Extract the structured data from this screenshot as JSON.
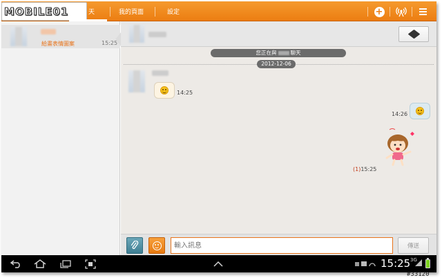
{
  "app": {
    "logo_text": "MOBILE01"
  },
  "tabs": [
    {
      "label": "聊天",
      "visible_label": "天",
      "active": true
    },
    {
      "label": "我的頁面",
      "active": false
    },
    {
      "label": "設定",
      "active": false
    }
  ],
  "top_icons": [
    "add-friend-icon",
    "signal-icon",
    "menu-icon"
  ],
  "conversation_list": [
    {
      "last_message": "給畫表情圖案",
      "time": "15:25",
      "selected": true
    }
  ],
  "chat": {
    "status_text_before": "您正在與",
    "status_text_after": "聊天",
    "date": "2012-12-06",
    "messages": [
      {
        "direction": "in",
        "content": "smiley-emoticon",
        "time": "14:25"
      },
      {
        "direction": "out",
        "content": "smiley-emoticon",
        "time": "14:26"
      },
      {
        "direction": "out",
        "content": "sticker-girl",
        "unread": "(1)",
        "time": "15:25"
      }
    ]
  },
  "input": {
    "placeholder": "輸入訊息",
    "send_label": "傳送"
  },
  "system_bar": {
    "clock": "15:25",
    "network": "3G"
  },
  "watermark": "#33120",
  "colors": {
    "accent": "#ec7d12",
    "chat_bg": "#edeae6",
    "unread": "#c13a1a"
  }
}
